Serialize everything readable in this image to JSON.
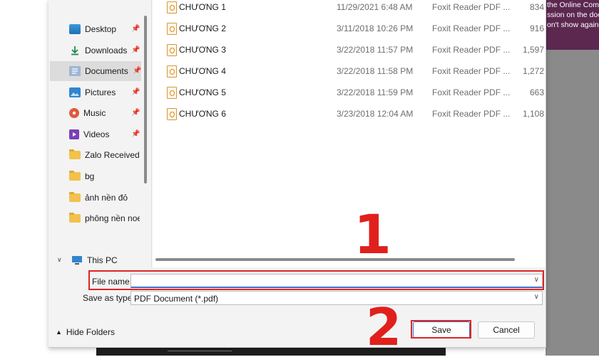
{
  "background": {
    "promo_lines": [
      "the Online Comme",
      "ssion on the doc",
      "on't show again"
    ]
  },
  "nav": {
    "items": [
      {
        "label": "Desktop",
        "icon": "desktop-icon",
        "pinned": true
      },
      {
        "label": "Downloads",
        "icon": "download-icon",
        "pinned": true
      },
      {
        "label": "Documents",
        "icon": "documents-icon",
        "pinned": true,
        "selected": true
      },
      {
        "label": "Pictures",
        "icon": "pictures-icon",
        "pinned": true
      },
      {
        "label": "Music",
        "icon": "music-icon",
        "pinned": true
      },
      {
        "label": "Videos",
        "icon": "videos-icon",
        "pinned": true
      },
      {
        "label": "Zalo Received F",
        "icon": "folder-icon",
        "pinned": false
      },
      {
        "label": "bg",
        "icon": "folder-icon",
        "pinned": false
      },
      {
        "label": "ảnh nền đỏ",
        "icon": "folder-icon",
        "pinned": false
      },
      {
        "label": "phông nền noel",
        "icon": "folder-icon",
        "pinned": false
      }
    ],
    "this_pc": "This PC"
  },
  "files": [
    {
      "name": "CHƯƠNG 1",
      "date": "11/29/2021 6:48 AM",
      "type": "Foxit Reader PDF ...",
      "size": "834"
    },
    {
      "name": "CHƯƠNG 2",
      "date": "3/11/2018 10:26 PM",
      "type": "Foxit Reader PDF ...",
      "size": "916"
    },
    {
      "name": "CHƯƠNG 3",
      "date": "3/22/2018 11:57 PM",
      "type": "Foxit Reader PDF ...",
      "size": "1,597"
    },
    {
      "name": "CHƯƠNG 4",
      "date": "3/22/2018 11:58 PM",
      "type": "Foxit Reader PDF ...",
      "size": "1,272"
    },
    {
      "name": "CHƯƠNG 5",
      "date": "3/22/2018 11:59 PM",
      "type": "Foxit Reader PDF ...",
      "size": "663"
    },
    {
      "name": "CHƯƠNG 6",
      "date": "3/23/2018 12:04 AM",
      "type": "Foxit Reader PDF ...",
      "size": "1,108"
    }
  ],
  "form": {
    "file_name_label": "File name:",
    "file_name_value": "",
    "save_type_label": "Save as type:",
    "save_type_value": "PDF Document (*.pdf)",
    "hide_folders": "Hide Folders",
    "save_button": "Save",
    "cancel_button": "Cancel"
  },
  "annotations": {
    "step1": "1",
    "step2": "2",
    "color": "#e0201c"
  }
}
